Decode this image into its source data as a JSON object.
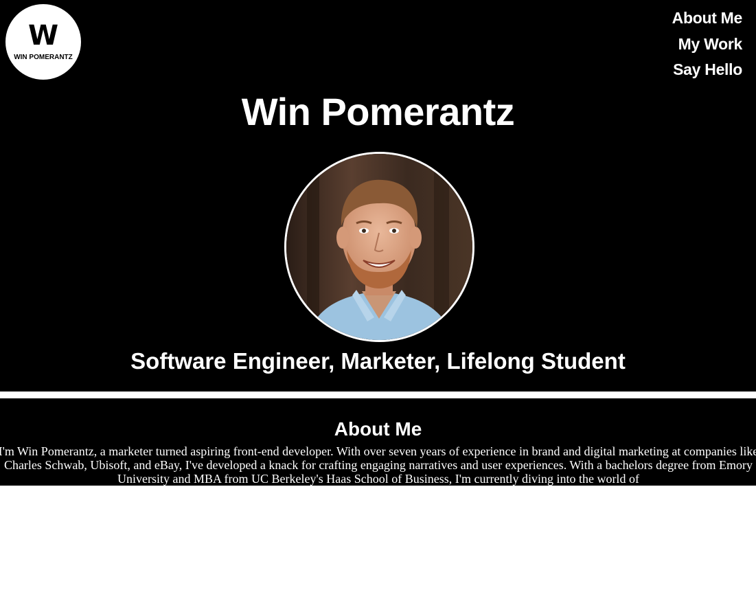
{
  "logo": {
    "letter": "W",
    "name": "WIN POMERANTZ"
  },
  "nav": {
    "items": [
      {
        "label": "About Me"
      },
      {
        "label": "My Work"
      },
      {
        "label": "Say Hello"
      }
    ]
  },
  "hero": {
    "title": "Win Pomerantz",
    "tagline": "Software Engineer, Marketer, Lifelong Student"
  },
  "about": {
    "heading": "About Me",
    "body": "I'm Win Pomerantz, a marketer turned aspiring front-end developer. With over seven years of experience in brand and digital marketing at companies like Charles Schwab, Ubisoft, and eBay, I've developed a knack for crafting engaging narratives and user experiences. With a bachelors degree from Emory University and MBA from UC Berkeley's Haas School of Business, I'm currently diving into the world of"
  },
  "colors": {
    "background": "#000000",
    "text": "#ffffff",
    "divider": "#ffffff"
  }
}
